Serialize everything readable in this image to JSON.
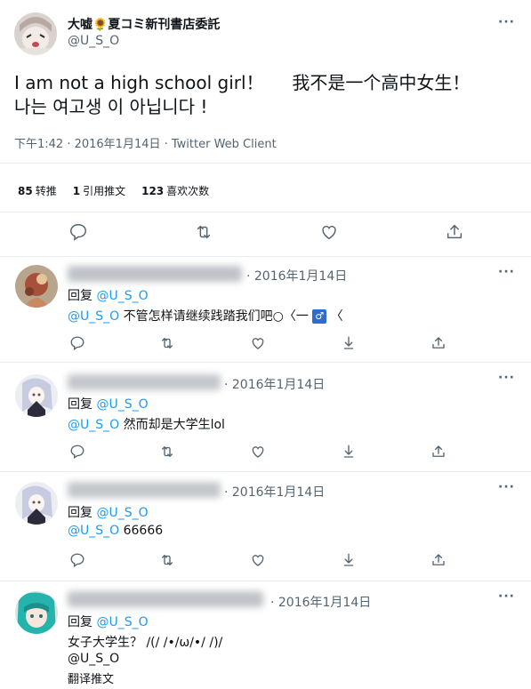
{
  "tweet": {
    "display_name": "大嘘🌻夏コミ新刊書店委託",
    "handle": "@U_S_O",
    "text": "I am not a high school girl！     我不是一个高中女生！\n나는 여고생 이 아닙니다 !",
    "meta": "下午1:42 · 2016年1月14日 · Twitter Web Client",
    "stats": [
      {
        "num": "85",
        "label": "转推"
      },
      {
        "num": "1",
        "label": "引用推文"
      },
      {
        "num": "123",
        "label": "喜欢次数"
      }
    ],
    "more_icon": "···"
  },
  "replies": [
    {
      "date": "· 2016年1月14日",
      "reply_label": "回复",
      "reply_to": "@U_S_O",
      "mention": "@U_S_O",
      "body": " 不管怎样请继续践踏我们吧○〈一",
      "badge": "♂",
      "body_tail": "〈"
    },
    {
      "date": "· 2016年1月14日",
      "reply_label": "回复",
      "reply_to": "@U_S_O",
      "mention": "@U_S_O",
      "body": " 然而却是大学生lol"
    },
    {
      "date": "· 2016年1月14日",
      "reply_label": "回复",
      "reply_to": "@U_S_O",
      "mention": "@U_S_O",
      "body": " 66666"
    },
    {
      "date": "· 2016年1月14日",
      "reply_label": "回复",
      "reply_to": "@U_S_O",
      "body": "女子大学生？ /(/ /•/ω/•/ /)/",
      "mention": "@U_S_O",
      "translate": "翻译推文"
    }
  ],
  "colors": {
    "link": "#1d9bf0",
    "secondary": "#536471",
    "divider": "#e6ecf0"
  },
  "icons": [
    "reply-icon",
    "retweet-icon",
    "like-icon",
    "share-icon",
    "more-icon"
  ]
}
